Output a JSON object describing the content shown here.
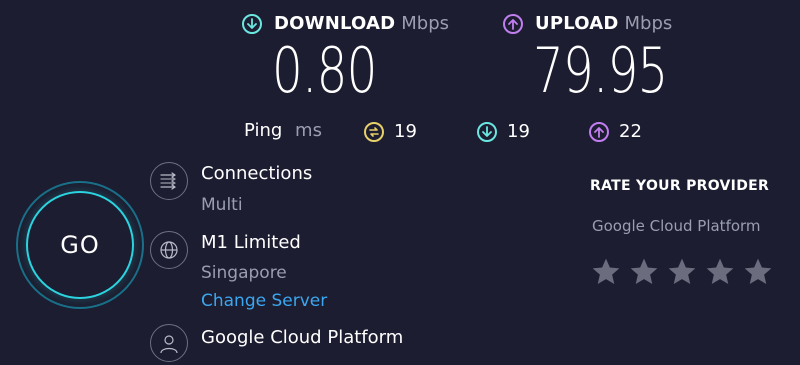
{
  "download": {
    "label": "DOWNLOAD",
    "unit": "Mbps",
    "value": "0.80",
    "icon": "arrow-down-circle-icon",
    "color": "#6be6e0"
  },
  "upload": {
    "label": "UPLOAD",
    "unit": "Mbps",
    "value": "79.95",
    "icon": "arrow-up-circle-icon",
    "color": "#c17ef0"
  },
  "ping": {
    "label": "Ping",
    "unit": "ms",
    "idle": "19",
    "download": "19",
    "upload": "22",
    "idle_color": "#e8d06a"
  },
  "go_button": {
    "label": "GO"
  },
  "connections": {
    "title": "Connections",
    "value": "Multi",
    "icon": "connections-icon"
  },
  "isp": {
    "name": "M1 Limited",
    "location": "Singapore",
    "change_server": "Change Server",
    "icon": "globe-icon"
  },
  "server": {
    "name": "Google Cloud Platform",
    "icon": "user-icon"
  },
  "rating": {
    "title": "RATE YOUR PROVIDER",
    "provider": "Google Cloud Platform",
    "stars": 5,
    "selected": 0
  },
  "colors": {
    "background": "#1c1d30",
    "link": "#3ba7f0",
    "muted": "#9b9db0"
  }
}
